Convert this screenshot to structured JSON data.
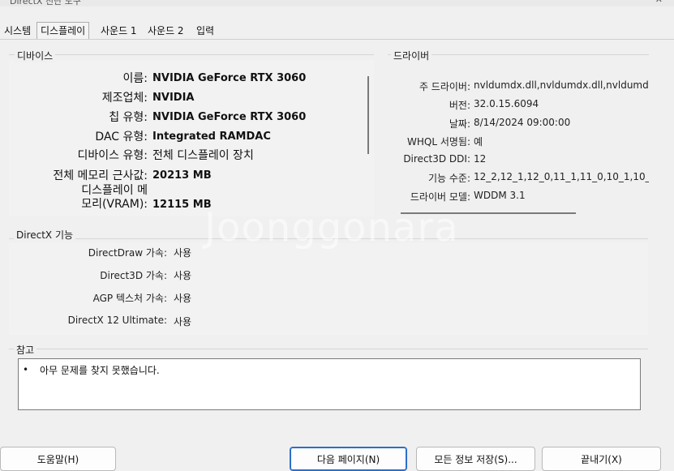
{
  "window": {
    "title": "DirectX 진단 도구",
    "close_glyph": "✕"
  },
  "tabs": [
    {
      "label": "시스템"
    },
    {
      "label": "디스플레이"
    },
    {
      "label": "사운드 1"
    },
    {
      "label": "사운드 2"
    },
    {
      "label": "입력"
    }
  ],
  "device": {
    "title": "디바이스",
    "rows": [
      {
        "label": "이름:",
        "value": "NVIDIA GeForce RTX 3060"
      },
      {
        "label": "제조업체:",
        "value": "NVIDIA"
      },
      {
        "label": "칩 유형:",
        "value": "NVIDIA GeForce RTX 3060"
      },
      {
        "label": "DAC 유형:",
        "value": "Integrated RAMDAC"
      },
      {
        "label": "디바이스 유형:",
        "value": "전체 디스플레이 장치"
      },
      {
        "label": "전체 메모리 근사값:",
        "value": "20213 MB"
      },
      {
        "label_line1": "디스플레이 메",
        "label_line2": "모리(VRAM):",
        "value": "12115 MB"
      }
    ]
  },
  "driver": {
    "title": "드라이버",
    "rows": [
      {
        "label": "주 드라이버:",
        "value": "nvldumdx.dll,nvldumdx.dll,nvldumdx.dl"
      },
      {
        "label": "버전:",
        "value": "32.0.15.6094"
      },
      {
        "label": "날짜:",
        "value": "8/14/2024 09:00:00"
      },
      {
        "label": "WHQL 서명됨:",
        "value": "예"
      },
      {
        "label": "Direct3D DDI:",
        "value": "12"
      },
      {
        "label": "기능 수준:",
        "value": "12_2,12_1,12_0,11_1,11_0,10_1,10_0,9_"
      },
      {
        "label": "드라이버 모델:",
        "value": "WDDM 3.1"
      }
    ]
  },
  "features": {
    "title": "DirectX 기능",
    "rows": [
      {
        "label": "DirectDraw 가속:",
        "value": "사용"
      },
      {
        "label": "Direct3D 가속:",
        "value": "사용"
      },
      {
        "label": "AGP 텍스처 가속:",
        "value": "사용"
      },
      {
        "label": "DirectX 12 Ultimate:",
        "value": "사용"
      }
    ]
  },
  "notes": {
    "title": "참고",
    "bullet": "•",
    "items": [
      "아무 문제를 찾지 못했습니다."
    ]
  },
  "buttons": {
    "help": "도움말(H)",
    "next_page": "다음 페이지(N)",
    "save_all": "모든 정보 저장(S)...",
    "exit": "끝내기(X)"
  },
  "watermark": "Joonggonara"
}
